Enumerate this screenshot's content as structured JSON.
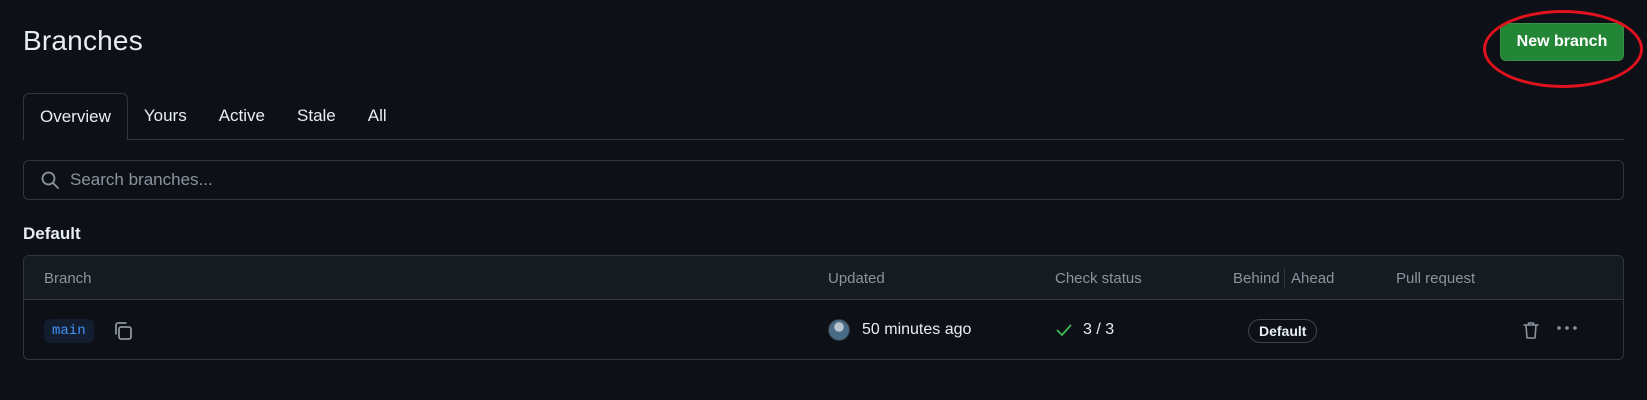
{
  "header": {
    "title": "Branches",
    "new_branch_label": "New branch"
  },
  "tabs": [
    {
      "label": "Overview",
      "selected": true
    },
    {
      "label": "Yours",
      "selected": false
    },
    {
      "label": "Active",
      "selected": false
    },
    {
      "label": "Stale",
      "selected": false
    },
    {
      "label": "All",
      "selected": false
    }
  ],
  "search": {
    "placeholder": "Search branches...",
    "value": "",
    "icon": "search-icon"
  },
  "default_section": {
    "heading": "Default",
    "columns": {
      "branch": "Branch",
      "updated": "Updated",
      "check_status": "Check status",
      "behind": "Behind",
      "ahead": "Ahead",
      "pull_request": "Pull request"
    },
    "rows": [
      {
        "branch": "main",
        "updated": "50 minutes ago",
        "check_status": "3 / 3",
        "badge": "Default"
      }
    ]
  },
  "colors": {
    "background": "#0d1117",
    "primary_button": "#238636",
    "highlight_ring": "#e0121e",
    "branch_link": "#4493f8",
    "success": "#3fb950"
  }
}
